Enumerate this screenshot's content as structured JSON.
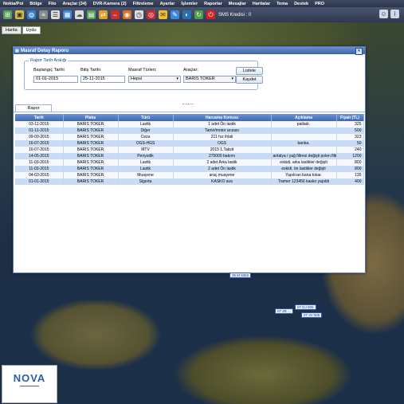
{
  "menu": [
    "Nokta/Poi",
    "Bölge",
    "Filo",
    "Araçlar (34)",
    "DVR-Kamera (2)",
    "Filtreleme",
    "Ayarlar",
    "İşlemler",
    "Raporlar",
    "Mesajlar",
    "Haritalar",
    "Tema",
    "Destek",
    "PRO"
  ],
  "toolbar": {
    "sms_label": "SMS Kredisi : 0"
  },
  "map_tabs": [
    "Harita",
    "Uydu"
  ],
  "dialog": {
    "title": "Masraf Detay Raporu",
    "filter_legend": "Rapor Tarih Aralığı",
    "start_label": "Başlangıç Tarihi",
    "start_value": "01-01-2015",
    "end_label": "Bitiş Tarihi",
    "end_value": "25-11-2015",
    "type_label": "Masraf Türleri:",
    "type_value": "Hepsi",
    "vehicle_label": "Araçlar:",
    "vehicle_value": "BARIS TOKER",
    "list_button": "Listele",
    "save_button": "Kaydet",
    "tab_label": "Rapor"
  },
  "table": {
    "columns": [
      "Tarih",
      "Plaka",
      "Türü",
      "Harcama Konusu",
      "Açıklama",
      "Fiyatı (TL)"
    ],
    "rows": [
      [
        "03-11-2015",
        "BARIS TOKER",
        "Lastik",
        "1 adet Ön lastik",
        "patladı.",
        "325"
      ],
      [
        "01-11-2015",
        "BARIS TOKER",
        "Diğer",
        "Tamir/motor arızası",
        "",
        "500"
      ],
      [
        "09-09-2015",
        "BARIS TOKER",
        "Ceza",
        "211 hız ihlali",
        "",
        "323"
      ],
      [
        "16-07-2015",
        "BARIS TOKER",
        "OGS-HGS",
        "OGS",
        "banka.",
        "50"
      ],
      [
        "10-07-2015",
        "BARIS TOKER",
        "MTV",
        "2015 1.Taksit",
        "",
        "240"
      ],
      [
        "14-05-2015",
        "BARIS TOKER",
        "Periyodik",
        "275000 bakımı",
        "antalya / yağ filtresi değişti polen filtresi değişti rot bagi",
        "1200"
      ],
      [
        "11-03-2015",
        "BARIS TOKER",
        "Lastik",
        "2 adet Arka lastik",
        "eskidi. arka lastikler değişti",
        "800"
      ],
      [
        "11-03-2015",
        "BARIS TOKER",
        "Lastik",
        "2 adet Ön lastik",
        "eskidi. ön lastikler değişti",
        "800"
      ],
      [
        "04-03-2015",
        "BARIS TOKER",
        "Muayene",
        "araç muayene",
        "Yapılıran bana tokar.",
        "135"
      ],
      [
        "01-01-2015",
        "BARIS TOKER",
        "Sigorta",
        "KASKO ava",
        "Tramer 123456 kasko yapıldı",
        "400"
      ]
    ]
  },
  "map_labels": [
    "35 M 8352",
    "07 DJ 005",
    "07 ZE ...",
    "07 JV 005"
  ],
  "logo": {
    "name": "NOVA"
  }
}
